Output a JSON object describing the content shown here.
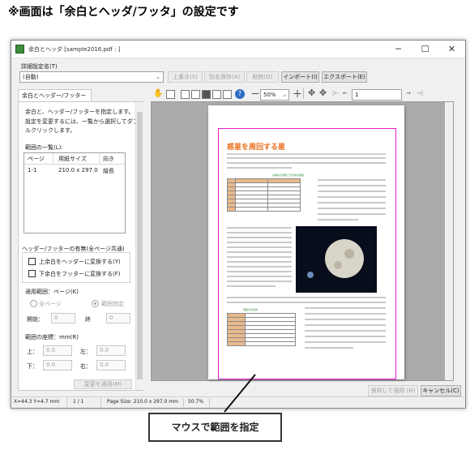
{
  "heading": "※画面は「余白とヘッダ/フッタ」の設定です",
  "window": {
    "title": "余白とヘッダ [sample2016.pdf : ]",
    "minimize": "─",
    "maximize": "☐",
    "close": "✕"
  },
  "preset": {
    "label": "詳細設定名(T)",
    "value": "(自動)",
    "buttons": [
      "上書き(S)",
      "別名保存(A)",
      "削除(D)",
      "インポート(I)",
      "エクスポート(E)"
    ]
  },
  "tab": {
    "label": "余白とヘッダー/フッター"
  },
  "panel": {
    "description": [
      "余白と、ヘッダー/フッターを指定します。",
      "設定を変更するには、一覧から選択してダブ",
      "ルクリックします。"
    ],
    "range_list_label": "範囲の一覧(L):",
    "table_headers": [
      "ページ",
      "用紙サイズ",
      "向き"
    ],
    "table_rows": [
      [
        "1-1",
        "210.0 x 297.0",
        "縦長"
      ]
    ],
    "hf_group_label": "ヘッダー/フッターの有無(全ページ共通)",
    "checkbox_header": "上余白をヘッダーに変換する(Y)",
    "checkbox_footer": "下余白をフッターに変換する(F)",
    "scope_label": "適用範囲：ページ(K)",
    "radio_all": "全ページ",
    "radio_range": "範囲指定",
    "start_label": "開始：",
    "start_value": "0",
    "end_label": "終",
    "end_value": "0",
    "coords_label": "範囲の座標：mm(R)",
    "top_label": "上：",
    "top_value": "0.0",
    "left_label": "左：",
    "left_value": "0.0",
    "bottom_label": "下：",
    "bottom_value": "0.0",
    "right_label": "右：",
    "right_value": "0.0",
    "apply_change": "変更を適用(M)"
  },
  "toolbar": {
    "zoom": "50%",
    "minus": "－",
    "plus": "＋",
    "page_value": "1",
    "prev": "←",
    "first": "|←",
    "next": "→",
    "last": "→|"
  },
  "document": {
    "title": "惑星を周回する星",
    "table_title": "太陽系の惑星と代表的な衛星",
    "table2_title": "惑星の代表的",
    "moon_bg": "#080d1c"
  },
  "footer_buttons": {
    "save_apply": "保存して適用 (H)",
    "cancel": "キャンセル(C)"
  },
  "status": {
    "coords": "X=44.3 Y=4.7 mm",
    "page": "1 / 1",
    "page_size": "Page Size: 210.0 x 297.0 mm",
    "zoom": "50.7%"
  },
  "callout": "マウスで範囲を指定"
}
